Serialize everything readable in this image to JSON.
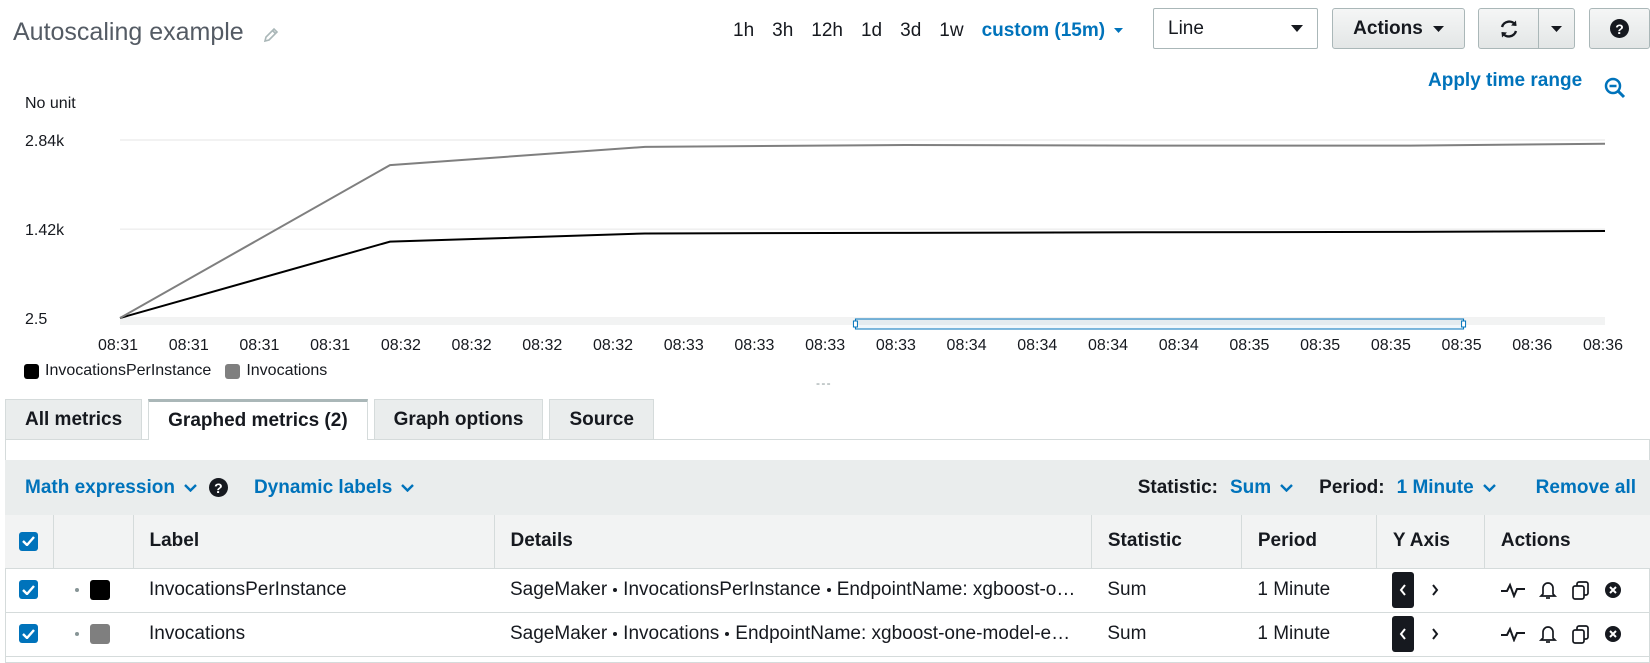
{
  "header": {
    "title": "Autoscaling example",
    "time_ranges": [
      "1h",
      "3h",
      "12h",
      "1d",
      "3d",
      "1w"
    ],
    "custom_range": "custom (15m)",
    "graph_type": "Line",
    "actions_label": "Actions",
    "help_label": "?"
  },
  "chart_top": {
    "apply_time_range": "Apply time range",
    "y_unit": "No unit"
  },
  "chart_data": {
    "type": "line",
    "ylabel": "No unit",
    "y_ticks": [
      "2.84k",
      "1.42k",
      "2.5"
    ],
    "ylim": [
      2.5,
      2840
    ],
    "x_ticks": [
      "08:31",
      "08:31",
      "08:31",
      "08:31",
      "08:32",
      "08:32",
      "08:32",
      "08:32",
      "08:33",
      "08:33",
      "08:33",
      "08:33",
      "08:34",
      "08:34",
      "08:34",
      "08:34",
      "08:35",
      "08:35",
      "08:35",
      "08:35",
      "08:36",
      "08:36"
    ],
    "x_points": [
      "08:31",
      "08:32",
      "08:33",
      "08:34",
      "08:35",
      "08:36",
      "08:36"
    ],
    "series": [
      {
        "name": "InvocationsPerInstance",
        "color": "#000000",
        "values": [
          2.5,
          1220,
          1350,
          1360,
          1370,
          1375,
          1390
        ]
      },
      {
        "name": "Invocations",
        "color": "#7f7f7f",
        "values": [
          2.5,
          2440,
          2730,
          2760,
          2750,
          2750,
          2780
        ]
      }
    ],
    "selection": [
      "08:33",
      "08:35"
    ],
    "grid": true,
    "legend": "bottom-left"
  },
  "legend": [
    {
      "label": "InvocationsPerInstance",
      "color": "#000000"
    },
    {
      "label": "Invocations",
      "color": "#7f7f7f"
    }
  ],
  "tabs": [
    "All metrics",
    "Graphed metrics (2)",
    "Graph options",
    "Source"
  ],
  "toolbar": {
    "math_expression": "Math expression",
    "dynamic_labels": "Dynamic labels",
    "statistic_label": "Statistic:",
    "statistic_value": "Sum",
    "period_label": "Period:",
    "period_value": "1 Minute",
    "remove_all": "Remove all"
  },
  "table": {
    "headers": [
      "Label",
      "Details",
      "Statistic",
      "Period",
      "Y Axis",
      "Actions"
    ],
    "rows": [
      {
        "label": "InvocationsPerInstance",
        "color": "#000000",
        "details_ns": "SageMaker",
        "details_metric": "InvocationsPerInstance",
        "details_dim": "EndpointName: xgboost-o…",
        "statistic": "Sum",
        "period": "1 Minute"
      },
      {
        "label": "Invocations",
        "color": "#7f7f7f",
        "details_ns": "SageMaker",
        "details_metric": "Invocations",
        "details_dim": "EndpointName: xgboost-one-model-e…",
        "statistic": "Sum",
        "period": "1 Minute"
      }
    ]
  }
}
